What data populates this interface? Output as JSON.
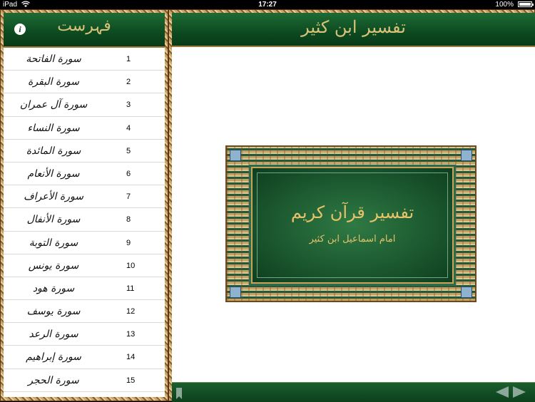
{
  "status_bar": {
    "device": "iPad",
    "time": "17:27",
    "battery": "100%"
  },
  "sidebar": {
    "title": "فہرست",
    "items": [
      {
        "number": "1",
        "name": "سورة الفاتحة"
      },
      {
        "number": "2",
        "name": "سورة البقرة"
      },
      {
        "number": "3",
        "name": "سورة آل عمران"
      },
      {
        "number": "4",
        "name": "سورة النساء"
      },
      {
        "number": "5",
        "name": "سورة المائدة"
      },
      {
        "number": "6",
        "name": "سورة الأنعام"
      },
      {
        "number": "7",
        "name": "سورة الأعراف"
      },
      {
        "number": "8",
        "name": "سورة الأنفال"
      },
      {
        "number": "9",
        "name": "سورة التوبة"
      },
      {
        "number": "10",
        "name": "سورة يونس"
      },
      {
        "number": "11",
        "name": "سورة هود"
      },
      {
        "number": "12",
        "name": "سورة يوسف"
      },
      {
        "number": "13",
        "name": "سورة الرعد"
      },
      {
        "number": "14",
        "name": "سورة إبراهيم"
      },
      {
        "number": "15",
        "name": "سورة الحجر"
      }
    ]
  },
  "main": {
    "title": "تفسیر ابن کثیر",
    "cover_title": "تفسیر قرآن کریم",
    "cover_subtitle": "امام اسماعیل ابن کثیر"
  },
  "icons": {
    "info": "info-icon",
    "bookmark": "bookmark-icon",
    "prev": "arrow-left-icon",
    "next": "arrow-right-icon"
  }
}
